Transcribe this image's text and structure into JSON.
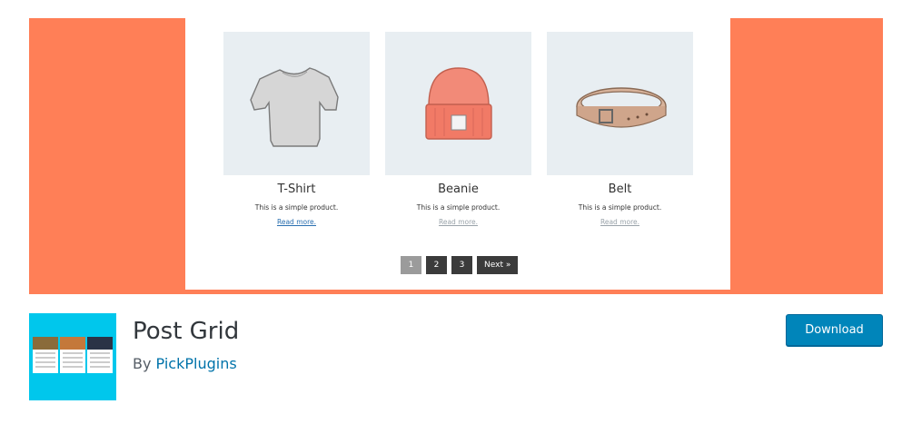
{
  "banner": {
    "background_color": "#ff7f57",
    "products": [
      {
        "title": "T-Shirt",
        "description": "This is a simple product.",
        "link": "Read more.",
        "icon": "tshirt-icon"
      },
      {
        "title": "Beanie",
        "description": "This is a simple product.",
        "link": "Read more.",
        "icon": "beanie-icon"
      },
      {
        "title": "Belt",
        "description": "This is a simple product.",
        "link": "Read more.",
        "icon": "belt-icon"
      }
    ],
    "pagination": {
      "pages": [
        "1",
        "2",
        "3"
      ],
      "current": "1",
      "next": "Next »"
    }
  },
  "plugin": {
    "name": "Post Grid",
    "author_prefix": "By",
    "author": "PickPlugins",
    "download_label": "Download",
    "thumbnail_color": "#00c7ec"
  }
}
